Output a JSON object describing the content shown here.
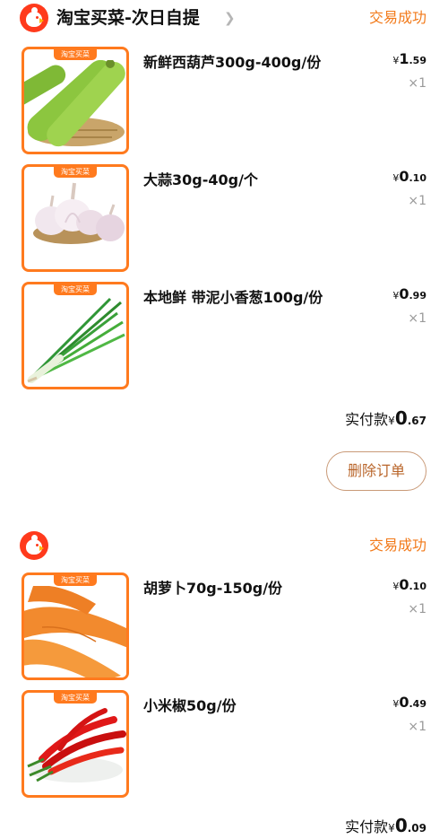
{
  "orders": [
    {
      "store_name": "淘宝买菜-次日自提",
      "status": "交易成功",
      "items": [
        {
          "title": "新鲜西葫芦300g-400g/份",
          "currency": "¥",
          "price_int": "1",
          "price_dec": ".59",
          "qty": "×1",
          "tag": "淘宝买菜",
          "image": "zucchini"
        },
        {
          "title": "大蒜30g-40g/个",
          "currency": "¥",
          "price_int": "0",
          "price_dec": ".10",
          "qty": "×1",
          "tag": "淘宝买菜",
          "image": "garlic"
        },
        {
          "title": "本地鲜 带泥小香葱100g/份",
          "currency": "¥",
          "price_int": "0",
          "price_dec": ".99",
          "qty": "×1",
          "tag": "淘宝买菜",
          "image": "scallion"
        }
      ],
      "total_label": "实付款",
      "total_currency": "¥",
      "total_int": "0",
      "total_dec": ".67",
      "delete_label": "删除订单"
    },
    {
      "store_name": "",
      "status": "交易成功",
      "items": [
        {
          "title": "胡萝卜70g-150g/份",
          "currency": "¥",
          "price_int": "0",
          "price_dec": ".10",
          "qty": "×1",
          "tag": "淘宝买菜",
          "image": "carrot"
        },
        {
          "title": "小米椒50g/份",
          "currency": "¥",
          "price_int": "0",
          "price_dec": ".49",
          "qty": "×1",
          "tag": "淘宝买菜",
          "image": "chili"
        }
      ],
      "total_label": "实付款",
      "total_currency": "¥",
      "total_int": "0",
      "total_dec": ".09"
    }
  ],
  "icons": {
    "store_logo": "taobao-maicai-chick-icon",
    "chevron": "chevron-right-icon"
  },
  "colors": {
    "status": "#f27a1a",
    "brand": "#ff3a1c",
    "thumb_border": "#ff7a1e",
    "delete_text": "#b9652a"
  }
}
